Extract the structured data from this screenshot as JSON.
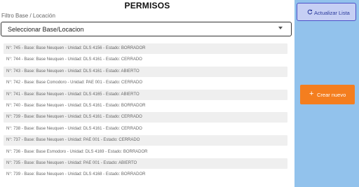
{
  "header": {
    "title": "PERMISOS"
  },
  "filter": {
    "label": "Filtro Base / Locación",
    "selected": "Seleccionar Base/Locacion"
  },
  "permits": [
    "N°: 745 - Base: Base Neuquen - Unidad: DLS 4156 - Estado: BORRADOR",
    "N°: 744 - Base: Base Neuquen - Unidad: DLS 4161 - Estado: CERRADO",
    "N°: 743 - Base: Base Neuquen - Unidad: DLS 4161 - Estado: ABIERTO",
    "N°: 742 - Base: Base Comodoro - Unidad: PAE 001 - Estado: CERRADO",
    "N°: 741 - Base: Base Neuquen - Unidad: DLS 4165 - Estado: ABIERTO",
    "N°: 740 - Base: Base Neuquen - Unidad: DLS 4161 - Estado: BORRADOR",
    "N°: 739 - Base: Base Neuquen - Unidad: DLS 4161 - Estado: CERRADO",
    "N°: 738 - Base: Base Neuquen - Unidad: DLS 4161 - Estado: CERRADO",
    "N°: 737 - Base: Base Neuquen - Unidad: PAE 001 - Estado: CERRADO",
    "N°: 736 - Base: Base Esmodoro - Unidad: DLS 4169 - Estado: BORRADOR",
    "N°: 735 - Base: Base Neuquen - Unidad: PAE 001 - Estado: ABIERTO",
    "N°: 739 - Base: Base Neuquen - Unidad: DLS 4168 - Estado: BORRADOR"
  ],
  "sidebar": {
    "refresh_label": "Actualizar Lista",
    "refresh_icon": "refresh-icon",
    "create_label": "Crear nuevo",
    "create_icon": "plus-icon"
  },
  "colors": {
    "sidebar_bg": "#92c2ec",
    "refresh_bg": "#c6cff4",
    "refresh_border": "#4d52c8",
    "create_bg": "#f47e1f"
  }
}
